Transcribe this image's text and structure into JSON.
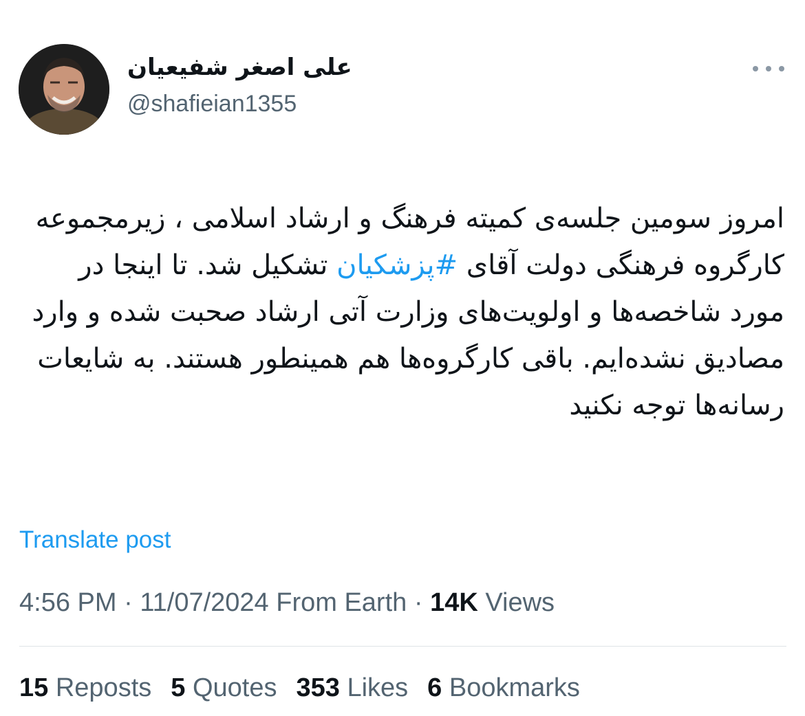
{
  "author": {
    "display_name": "علی اصغر شفیعیان",
    "handle": "@shafieian1355"
  },
  "tweet": {
    "text_before": "امروز سومین جلسه‌ی کمیته فرهنگ و ارشاد اسلامی ، زیرمجموعه کارگروه فرهنگی دولت آقای ",
    "hashtag": "#پزشکیان",
    "text_after": " تشکیل شد. تا اینجا در مورد شاخصه‌ها و اولویت‌های وزارت آتی ارشاد صحبت شده و وارد مصادیق نشده‌ایم. باقی کارگروه‌ها هم همینطور هستند. به شایعات رسانه‌ها توجه نکنید"
  },
  "translate_label": "Translate post",
  "meta": {
    "time": "4:56 PM",
    "sep1": " · ",
    "date": "11/07/2024",
    "source": " From Earth",
    "sep2": " · ",
    "views_count": "14K",
    "views_label": " Views"
  },
  "stats": {
    "reposts_count": "15",
    "reposts_label": "Reposts",
    "quotes_count": "5",
    "quotes_label": "Quotes",
    "likes_count": "353",
    "likes_label": "Likes",
    "bookmarks_count": "6",
    "bookmarks_label": "Bookmarks"
  },
  "icons": {
    "more": "more-horizontal-icon"
  },
  "colors": {
    "link": "#1d9bf0",
    "primary_text": "#0f1419",
    "secondary_text": "#536471",
    "divider": "#dfe3e6"
  }
}
